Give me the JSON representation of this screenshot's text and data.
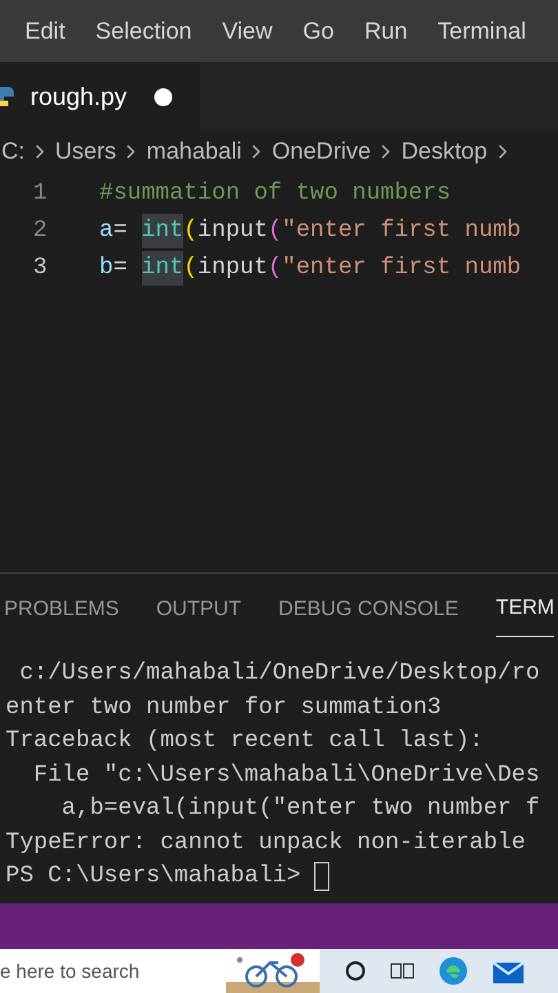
{
  "menu_bar": {
    "items": [
      "Edit",
      "Selection",
      "View",
      "Go",
      "Run",
      "Terminal"
    ]
  },
  "editor_tabs": [
    {
      "label": "rough.py",
      "selected": true,
      "modified": true
    }
  ],
  "breadcrumb": [
    "C:",
    "Users",
    "mahabali",
    "OneDrive",
    "Desktop"
  ],
  "code_lines": [
    {
      "number": "1",
      "current": false,
      "tokens": [
        {
          "kind": "comment",
          "text": "#summation of two numbers"
        }
      ]
    },
    {
      "number": "2",
      "current": false,
      "tokens": [
        {
          "kind": "var",
          "text": "a"
        },
        {
          "kind": "plain",
          "text": "= "
        },
        {
          "kind": "func",
          "text": "int",
          "highlighted": true
        },
        {
          "kind": "paren",
          "text": "("
        },
        {
          "kind": "plain",
          "text": "input"
        },
        {
          "kind": "paren2",
          "text": "("
        },
        {
          "kind": "string",
          "text": "\"enter first numb"
        }
      ]
    },
    {
      "number": "3",
      "current": true,
      "tokens": [
        {
          "kind": "var",
          "text": "b"
        },
        {
          "kind": "plain",
          "text": "= "
        },
        {
          "kind": "func",
          "text": "int",
          "highlighted": true
        },
        {
          "kind": "paren",
          "text": "("
        },
        {
          "kind": "plain",
          "text": "input"
        },
        {
          "kind": "paren2",
          "text": "("
        },
        {
          "kind": "string",
          "text": "\"enter first numb"
        }
      ]
    }
  ],
  "panel_tabs": [
    {
      "label": "PROBLEMS",
      "selected": false
    },
    {
      "label": "OUTPUT",
      "selected": false
    },
    {
      "label": "DEBUG CONSOLE",
      "selected": false
    },
    {
      "label": "TERM",
      "selected": true
    }
  ],
  "terminal": {
    "lines": [
      " c:/Users/mahabali/OneDrive/Desktop/ro",
      "enter two number for summation3",
      "Traceback (most recent call last):",
      "  File \"c:\\Users\\mahabali\\OneDrive\\Des",
      "    a,b=eval(input(\"enter two number f",
      "TypeError: cannot unpack non-iterable "
    ],
    "prompt": "PS C:\\Users\\mahabali> "
  },
  "taskbar": {
    "search_placeholder": "e here to search"
  }
}
